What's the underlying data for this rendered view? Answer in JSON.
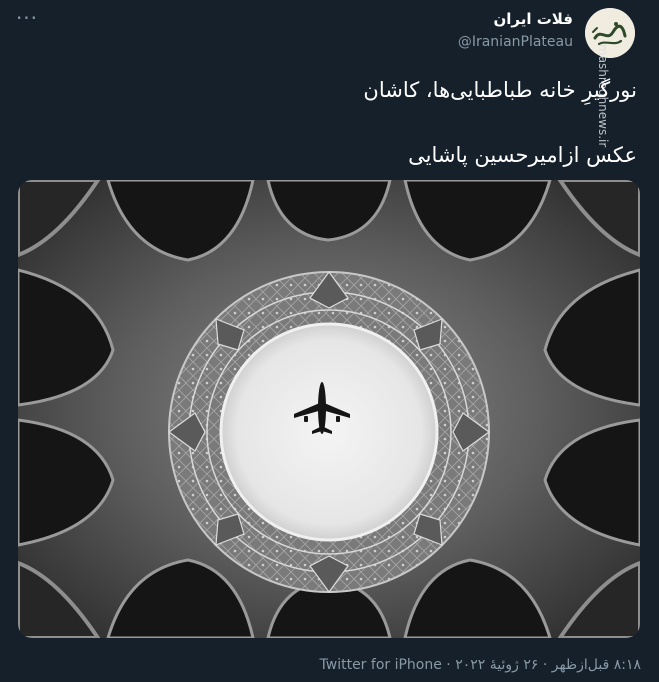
{
  "tweet": {
    "more_label": "···",
    "author": {
      "display_name": "فلات ایران",
      "handle": "@IranianPlateau",
      "avatar_icon": "calligraphy-logo-icon"
    },
    "watermark": "mashreghnews.ir",
    "text_line1": "نورگیرِ خانه طباطبایی‌ها، کاشان",
    "text_line2": "عکس ازامیرحسین پاشایی",
    "media": {
      "image_icon": "dome-skylight-airplane-photo"
    },
    "meta": {
      "time": "۸:۱۸ قبل‌ازظهر",
      "separator1": " · ",
      "date": "۲۶ ژوئیهٔ ۲۰۲۲",
      "separator2": " · ",
      "source": "Twitter for iPhone"
    }
  }
}
